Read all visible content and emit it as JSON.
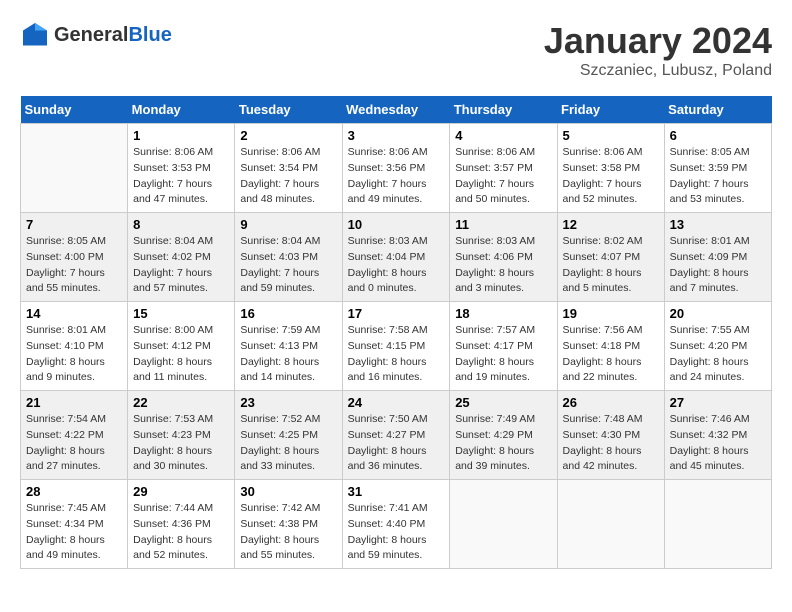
{
  "logo": {
    "general": "General",
    "blue": "Blue"
  },
  "title": "January 2024",
  "location": "Szczaniec, Lubusz, Poland",
  "days_of_week": [
    "Sunday",
    "Monday",
    "Tuesday",
    "Wednesday",
    "Thursday",
    "Friday",
    "Saturday"
  ],
  "weeks": [
    [
      {
        "day": "",
        "sunrise": "",
        "sunset": "",
        "daylight": ""
      },
      {
        "day": "1",
        "sunrise": "Sunrise: 8:06 AM",
        "sunset": "Sunset: 3:53 PM",
        "daylight": "Daylight: 7 hours and 47 minutes."
      },
      {
        "day": "2",
        "sunrise": "Sunrise: 8:06 AM",
        "sunset": "Sunset: 3:54 PM",
        "daylight": "Daylight: 7 hours and 48 minutes."
      },
      {
        "day": "3",
        "sunrise": "Sunrise: 8:06 AM",
        "sunset": "Sunset: 3:56 PM",
        "daylight": "Daylight: 7 hours and 49 minutes."
      },
      {
        "day": "4",
        "sunrise": "Sunrise: 8:06 AM",
        "sunset": "Sunset: 3:57 PM",
        "daylight": "Daylight: 7 hours and 50 minutes."
      },
      {
        "day": "5",
        "sunrise": "Sunrise: 8:06 AM",
        "sunset": "Sunset: 3:58 PM",
        "daylight": "Daylight: 7 hours and 52 minutes."
      },
      {
        "day": "6",
        "sunrise": "Sunrise: 8:05 AM",
        "sunset": "Sunset: 3:59 PM",
        "daylight": "Daylight: 7 hours and 53 minutes."
      }
    ],
    [
      {
        "day": "7",
        "sunrise": "Sunrise: 8:05 AM",
        "sunset": "Sunset: 4:00 PM",
        "daylight": "Daylight: 7 hours and 55 minutes."
      },
      {
        "day": "8",
        "sunrise": "Sunrise: 8:04 AM",
        "sunset": "Sunset: 4:02 PM",
        "daylight": "Daylight: 7 hours and 57 minutes."
      },
      {
        "day": "9",
        "sunrise": "Sunrise: 8:04 AM",
        "sunset": "Sunset: 4:03 PM",
        "daylight": "Daylight: 7 hours and 59 minutes."
      },
      {
        "day": "10",
        "sunrise": "Sunrise: 8:03 AM",
        "sunset": "Sunset: 4:04 PM",
        "daylight": "Daylight: 8 hours and 0 minutes."
      },
      {
        "day": "11",
        "sunrise": "Sunrise: 8:03 AM",
        "sunset": "Sunset: 4:06 PM",
        "daylight": "Daylight: 8 hours and 3 minutes."
      },
      {
        "day": "12",
        "sunrise": "Sunrise: 8:02 AM",
        "sunset": "Sunset: 4:07 PM",
        "daylight": "Daylight: 8 hours and 5 minutes."
      },
      {
        "day": "13",
        "sunrise": "Sunrise: 8:01 AM",
        "sunset": "Sunset: 4:09 PM",
        "daylight": "Daylight: 8 hours and 7 minutes."
      }
    ],
    [
      {
        "day": "14",
        "sunrise": "Sunrise: 8:01 AM",
        "sunset": "Sunset: 4:10 PM",
        "daylight": "Daylight: 8 hours and 9 minutes."
      },
      {
        "day": "15",
        "sunrise": "Sunrise: 8:00 AM",
        "sunset": "Sunset: 4:12 PM",
        "daylight": "Daylight: 8 hours and 11 minutes."
      },
      {
        "day": "16",
        "sunrise": "Sunrise: 7:59 AM",
        "sunset": "Sunset: 4:13 PM",
        "daylight": "Daylight: 8 hours and 14 minutes."
      },
      {
        "day": "17",
        "sunrise": "Sunrise: 7:58 AM",
        "sunset": "Sunset: 4:15 PM",
        "daylight": "Daylight: 8 hours and 16 minutes."
      },
      {
        "day": "18",
        "sunrise": "Sunrise: 7:57 AM",
        "sunset": "Sunset: 4:17 PM",
        "daylight": "Daylight: 8 hours and 19 minutes."
      },
      {
        "day": "19",
        "sunrise": "Sunrise: 7:56 AM",
        "sunset": "Sunset: 4:18 PM",
        "daylight": "Daylight: 8 hours and 22 minutes."
      },
      {
        "day": "20",
        "sunrise": "Sunrise: 7:55 AM",
        "sunset": "Sunset: 4:20 PM",
        "daylight": "Daylight: 8 hours and 24 minutes."
      }
    ],
    [
      {
        "day": "21",
        "sunrise": "Sunrise: 7:54 AM",
        "sunset": "Sunset: 4:22 PM",
        "daylight": "Daylight: 8 hours and 27 minutes."
      },
      {
        "day": "22",
        "sunrise": "Sunrise: 7:53 AM",
        "sunset": "Sunset: 4:23 PM",
        "daylight": "Daylight: 8 hours and 30 minutes."
      },
      {
        "day": "23",
        "sunrise": "Sunrise: 7:52 AM",
        "sunset": "Sunset: 4:25 PM",
        "daylight": "Daylight: 8 hours and 33 minutes."
      },
      {
        "day": "24",
        "sunrise": "Sunrise: 7:50 AM",
        "sunset": "Sunset: 4:27 PM",
        "daylight": "Daylight: 8 hours and 36 minutes."
      },
      {
        "day": "25",
        "sunrise": "Sunrise: 7:49 AM",
        "sunset": "Sunset: 4:29 PM",
        "daylight": "Daylight: 8 hours and 39 minutes."
      },
      {
        "day": "26",
        "sunrise": "Sunrise: 7:48 AM",
        "sunset": "Sunset: 4:30 PM",
        "daylight": "Daylight: 8 hours and 42 minutes."
      },
      {
        "day": "27",
        "sunrise": "Sunrise: 7:46 AM",
        "sunset": "Sunset: 4:32 PM",
        "daylight": "Daylight: 8 hours and 45 minutes."
      }
    ],
    [
      {
        "day": "28",
        "sunrise": "Sunrise: 7:45 AM",
        "sunset": "Sunset: 4:34 PM",
        "daylight": "Daylight: 8 hours and 49 minutes."
      },
      {
        "day": "29",
        "sunrise": "Sunrise: 7:44 AM",
        "sunset": "Sunset: 4:36 PM",
        "daylight": "Daylight: 8 hours and 52 minutes."
      },
      {
        "day": "30",
        "sunrise": "Sunrise: 7:42 AM",
        "sunset": "Sunset: 4:38 PM",
        "daylight": "Daylight: 8 hours and 55 minutes."
      },
      {
        "day": "31",
        "sunrise": "Sunrise: 7:41 AM",
        "sunset": "Sunset: 4:40 PM",
        "daylight": "Daylight: 8 hours and 59 minutes."
      },
      {
        "day": "",
        "sunrise": "",
        "sunset": "",
        "daylight": ""
      },
      {
        "day": "",
        "sunrise": "",
        "sunset": "",
        "daylight": ""
      },
      {
        "day": "",
        "sunrise": "",
        "sunset": "",
        "daylight": ""
      }
    ]
  ]
}
